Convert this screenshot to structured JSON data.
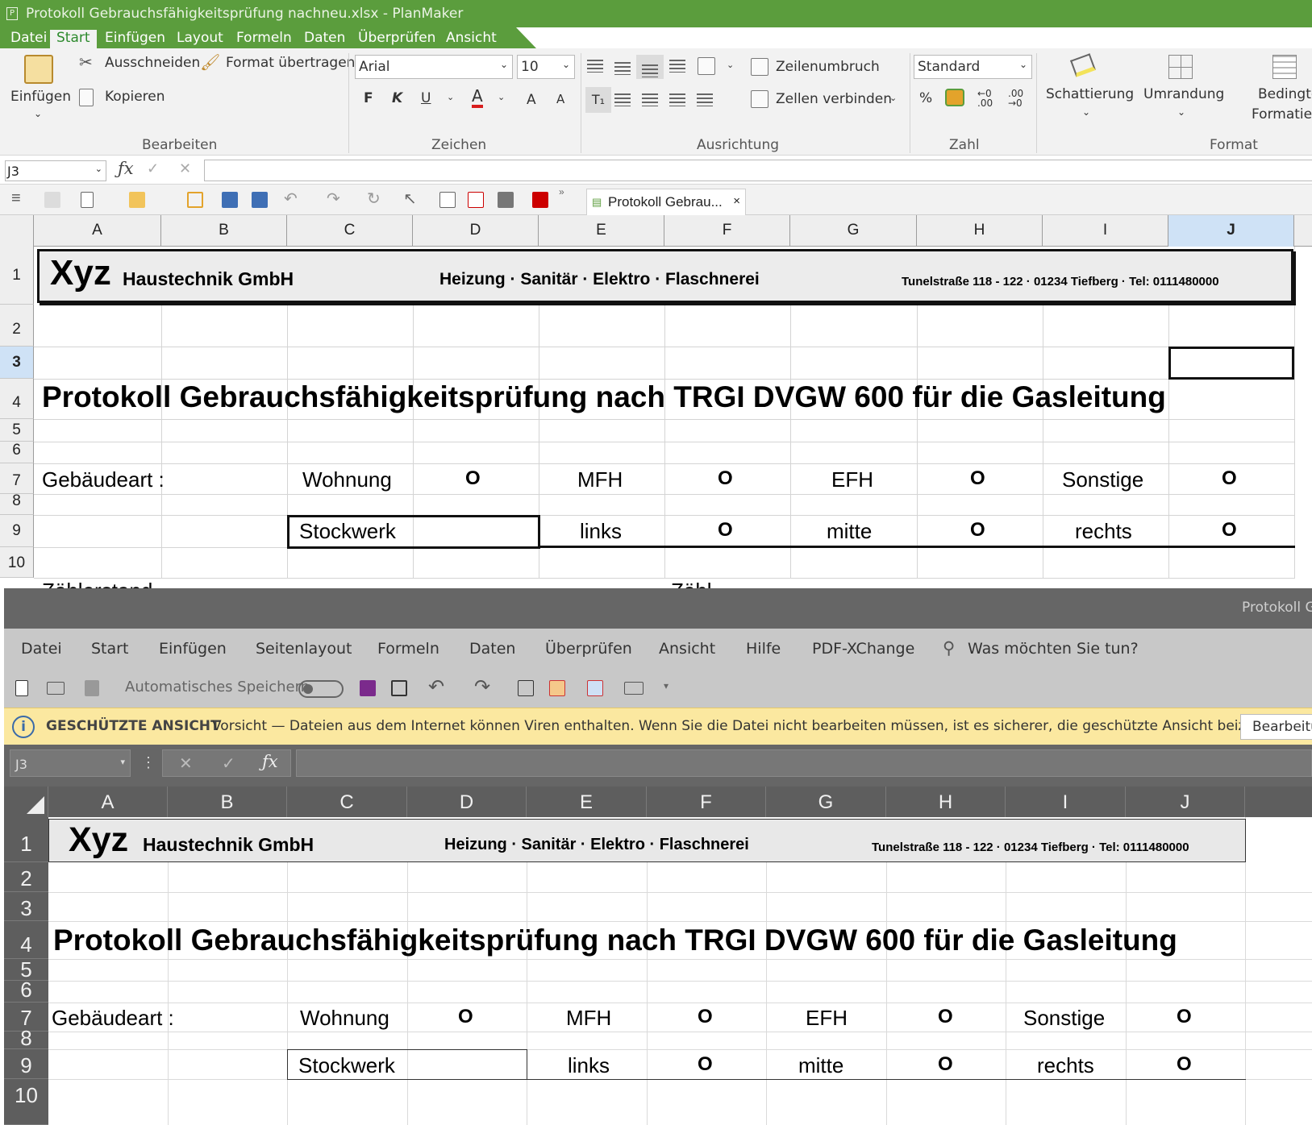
{
  "planmaker": {
    "title": "Protokoll Gebrauchsfähigkeitsprüfung nachneu.xlsx - PlanMaker",
    "app_icon": "P",
    "menu": [
      "Datei",
      "Start",
      "Einfügen",
      "Layout",
      "Formeln",
      "Daten",
      "Überprüfen",
      "Ansicht"
    ],
    "active_menu": "Start",
    "ribbon": {
      "paste": "Einfügen",
      "cut": "Ausschneiden",
      "copy": "Kopieren",
      "format_painter": "Format übertragen",
      "font_name": "Arial",
      "font_size": "10",
      "bold": "F",
      "italic": "K",
      "underline": "U",
      "font_color": "A",
      "grow": "A",
      "shrink": "A",
      "wrap": "Zeilenumbruch",
      "merge": "Zellen verbinden",
      "number_format": "Standard",
      "percent": "%",
      "shading": "Schattierung",
      "border": "Umrandung",
      "conditional_1": "Bedingte",
      "conditional_2": "Formatierung",
      "groups": [
        "Bearbeiten",
        "Zeichen",
        "Ausrichtung",
        "Zahl",
        "Format"
      ],
      "accent": "#5b9d3d"
    },
    "name_box": "J3",
    "doc_tab": "Protokoll Gebrau...",
    "columns": [
      "A",
      "B",
      "C",
      "D",
      "E",
      "F",
      "G",
      "H",
      "I",
      "J"
    ],
    "rows": [
      "1",
      "2",
      "3",
      "4",
      "5",
      "6",
      "7",
      "8",
      "9",
      "10"
    ],
    "partial_row11_a": "Zählerstand",
    "partial_row11_f": "Zähl"
  },
  "excel": {
    "title_partial": "Protokoll G",
    "menu": [
      "Datei",
      "Start",
      "Einfügen",
      "Seitenlayout",
      "Formeln",
      "Daten",
      "Überprüfen",
      "Ansicht",
      "Hilfe",
      "PDF-XChange"
    ],
    "tell_me": "Was möchten Sie tun?",
    "autosave": "Automatisches Speichern",
    "warning_title": "GESCHÜTZTE ANSICHT",
    "warning_text": "Vorsicht — Dateien aus dem Internet können Viren enthalten. Wenn Sie die Datei nicht bearbeiten müssen, ist es sicherer, die geschützte Ansicht beizubehalten.",
    "enable_editing": "Bearbeitung aktivieren",
    "name_box": "J3",
    "columns": [
      "A",
      "B",
      "C",
      "D",
      "E",
      "F",
      "G",
      "H",
      "I",
      "J"
    ],
    "rows": [
      "1",
      "2",
      "3",
      "4",
      "5",
      "6",
      "7",
      "8",
      "9",
      "10"
    ]
  },
  "sheet": {
    "logo": "Xyz",
    "company": "Haustechnik GmbH",
    "trades": "Heizung · Sanitär · Elektro · Flaschnerei",
    "address": "Tunelstraße 118 - 122  ·  01234  Tiefberg · Tel: 0111480000",
    "heading": "Protokoll Gebrauchsfähigkeitsprüfung nach TRGI DVGW 600 für die Gasleitung",
    "gebaeudeart": "Gebäudeart :",
    "wohnung": "Wohnung",
    "mfh": "MFH",
    "efh": "EFH",
    "sonstige": "Sonstige",
    "circle": "O",
    "stockwerk": "Stockwerk",
    "links": "links",
    "mitte": "mitte",
    "rechts": "rechts"
  }
}
